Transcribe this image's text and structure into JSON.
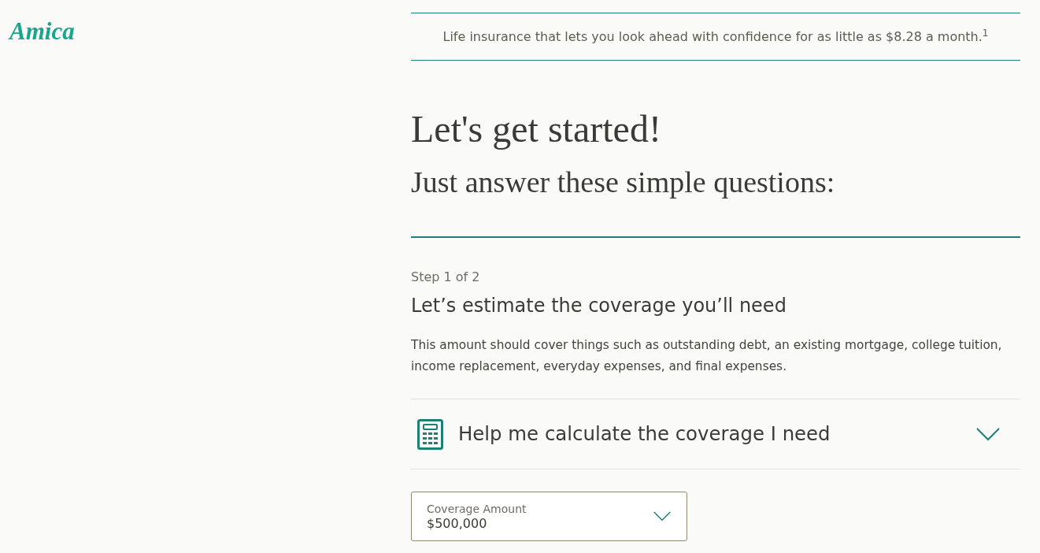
{
  "logo": {
    "text": "Amica"
  },
  "banner": {
    "text": "Life insurance that lets you look ahead with confidence for as little as $8.28 a month.$^{1}$"
  },
  "hero": {
    "title": "Let's get started!",
    "subtitle": "Just answer these simple questions:"
  },
  "step": {
    "label": "Step 1 of 2",
    "heading": "Let’s estimate the coverage you’ll need",
    "description": "This amount should cover things such as outstanding debt, an existing mortgage, college tuition, income replacement, everyday expenses, and final expenses."
  },
  "calculator_accordion": {
    "label": "Help me calculate the coverage I need",
    "expanded": false
  },
  "coverage_select": {
    "label": "Coverage Amount",
    "value": "$500,000"
  }
}
